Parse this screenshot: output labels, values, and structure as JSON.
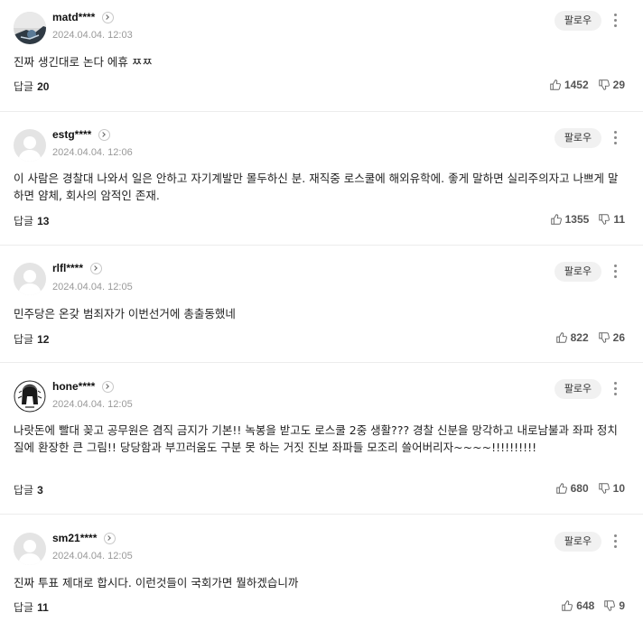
{
  "comments": [
    {
      "username": "matd****",
      "date": "2024.04.04. 12:03",
      "follow": "팔로우",
      "text": "진짜 생긴대로 논다 에휴 ㅉㅉ",
      "reply_label": "답글",
      "reply_count": "20",
      "likes": "1452",
      "dislikes": "29",
      "avatar": "photo"
    },
    {
      "username": "estg****",
      "date": "2024.04.04. 12:06",
      "follow": "팔로우",
      "text": "이 사람은 경찰대 나와서 일은 안하고 자기계발만 몰두하신 분. 재직중 로스쿨에 해외유학에. 좋게 말하면 실리주의자고 나쁘게 말하면 얌체, 회사의 암적인 존재.",
      "reply_label": "답글",
      "reply_count": "13",
      "likes": "1355",
      "dislikes": "11",
      "avatar": "default"
    },
    {
      "username": "rlfl****",
      "date": "2024.04.04. 12:05",
      "follow": "팔로우",
      "text": "민주당은 온갖 범죄자가 이번선거에 총출동했네",
      "reply_label": "답글",
      "reply_count": "12",
      "likes": "822",
      "dislikes": "26",
      "avatar": "default"
    },
    {
      "username": "hone****",
      "date": "2024.04.04. 12:05",
      "follow": "팔로우",
      "text": "나랏돈에 빨대 꽂고 공무원은 겸직 금지가 기본!! 녹봉을 받고도 로스쿨 2중 생활??? 경찰 신분을 망각하고 내로남불과 좌파 정치질에 환장한 큰 그림!! 당당함과 부끄러움도 구분 못 하는 거짓 진보 좌파들 모조리 쓸어버리자~~~~!!!!!!!!!!",
      "reply_label": "답글",
      "reply_count": "3",
      "likes": "680",
      "dislikes": "10",
      "avatar": "helmet"
    },
    {
      "username": "sm21****",
      "date": "2024.04.04. 12:05",
      "follow": "팔로우",
      "text": "진짜 투표 제대로 합시다. 이런것들이 국회가면 뭘하겠습니까",
      "reply_label": "답글",
      "reply_count": "11",
      "likes": "648",
      "dislikes": "9",
      "avatar": "default"
    }
  ]
}
